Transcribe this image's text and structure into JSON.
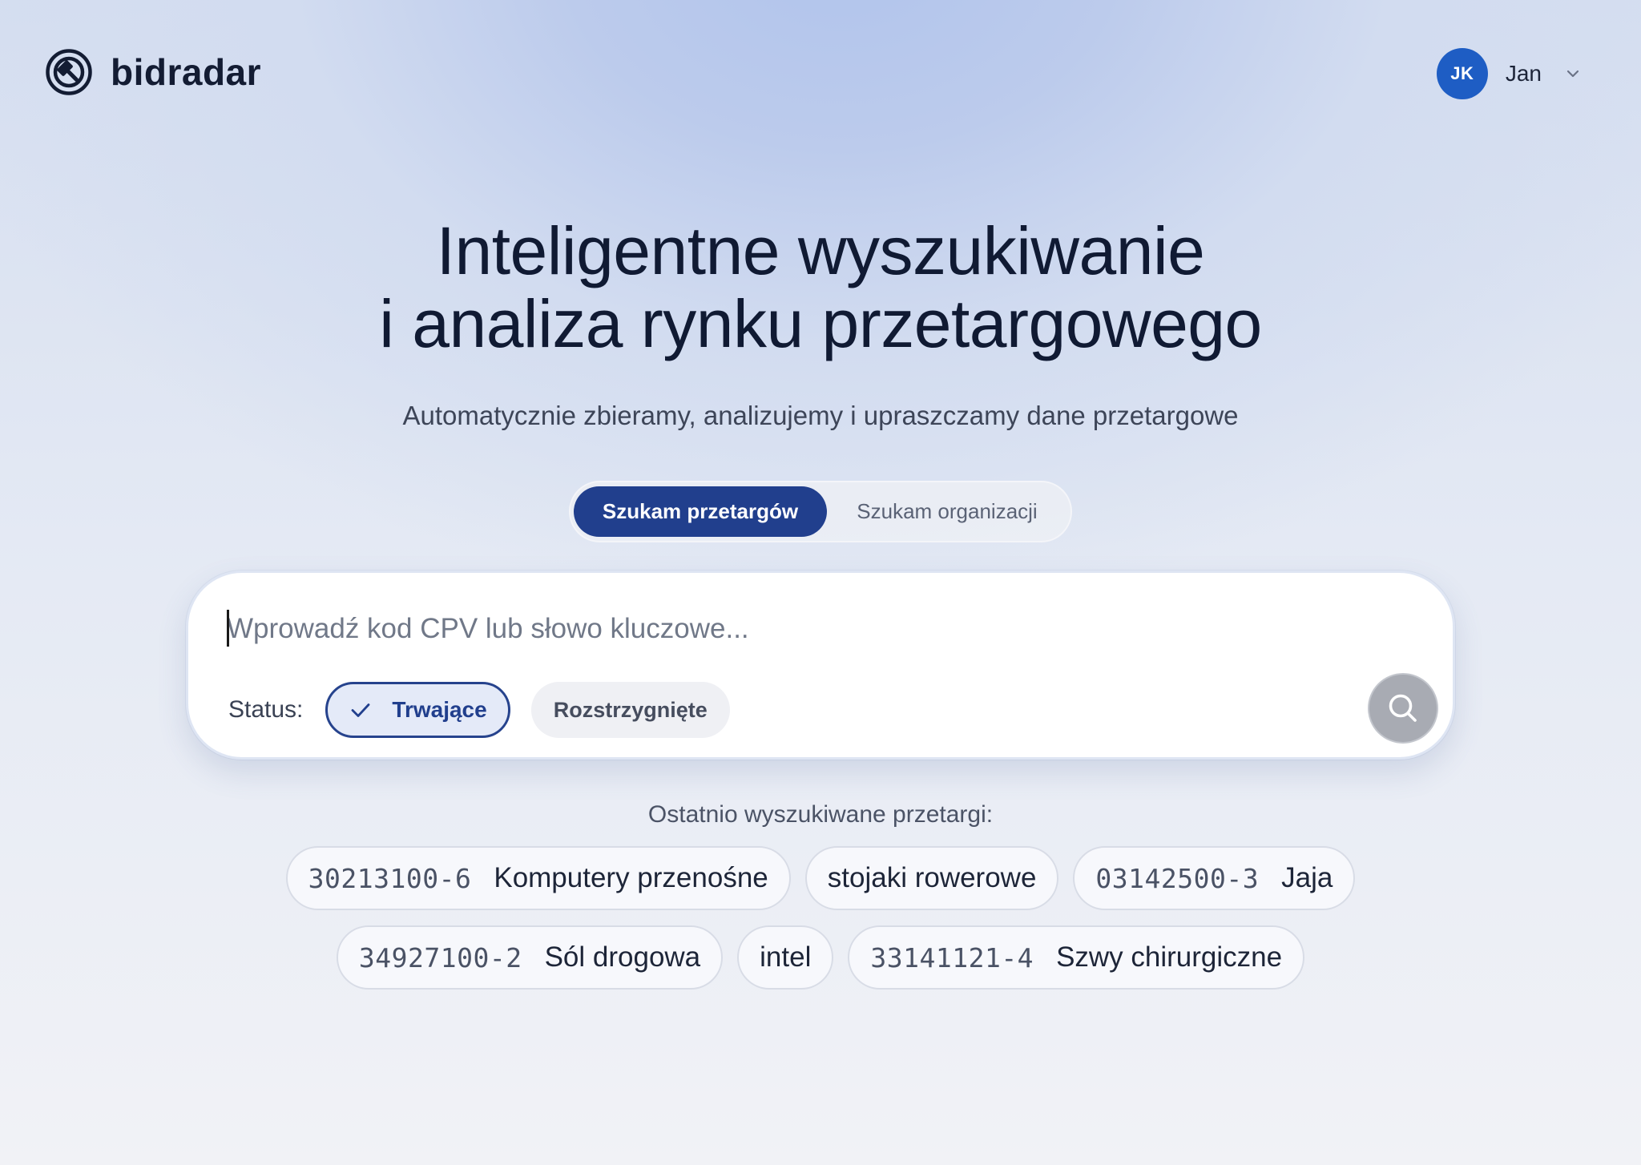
{
  "header": {
    "logo_text": "bidradar",
    "user": {
      "initials": "JK",
      "name": "Jan"
    }
  },
  "hero": {
    "title_line1": "Inteligentne wyszukiwanie",
    "title_line2": "i analiza rynku przetargowego",
    "subtitle": "Automatycznie zbieramy, analizujemy i upraszczamy dane przetargowe"
  },
  "mode_toggle": {
    "options": [
      {
        "label": "Szukam przetargów",
        "selected": true
      },
      {
        "label": "Szukam organizacji",
        "selected": false
      }
    ]
  },
  "search": {
    "value": "",
    "placeholder": "Wprowadź kod CPV lub słowo kluczowe...",
    "status_label": "Status:",
    "status_filters": [
      {
        "label": "Trwające",
        "selected": true
      },
      {
        "label": "Rozstrzygnięte",
        "selected": false
      }
    ]
  },
  "recent": {
    "label": "Ostatnio wyszukiwane przetargi:",
    "items": [
      {
        "code": "30213100-6",
        "label": "Komputery przenośne"
      },
      {
        "code": "",
        "label": "stojaki rowerowe"
      },
      {
        "code": "03142500-3",
        "label": "Jaja"
      },
      {
        "code": "34927100-2",
        "label": "Sól drogowa"
      },
      {
        "code": "",
        "label": "intel"
      },
      {
        "code": "33141121-4",
        "label": "Szwy chirurgiczne"
      }
    ]
  },
  "colors": {
    "primary": "#213f8d",
    "avatar": "#1e5dc4",
    "search_button": "#a8abb3"
  }
}
